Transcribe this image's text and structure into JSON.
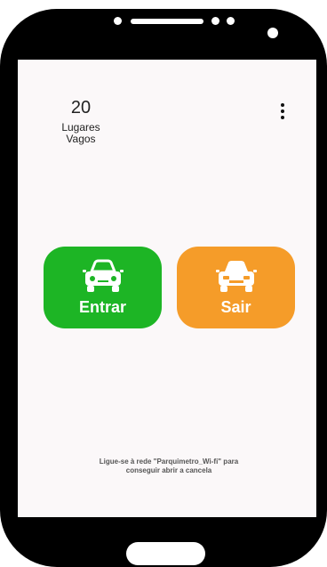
{
  "status": {
    "free_spots_count": "20",
    "free_spots_label_line1": "Lugares",
    "free_spots_label_line2": "Vagos"
  },
  "menu": {
    "icon": "more-vert-icon"
  },
  "actions": {
    "enter_label": "Entrar",
    "exit_label": "Sair",
    "enter_color": "#1db525",
    "exit_color": "#f59c29",
    "icon": "car-icon"
  },
  "footer": {
    "hint_line1": "Ligue-se à rede \"Parquimetro_Wi-fi\" para",
    "hint_line2": "conseguir abrir a cancela"
  }
}
